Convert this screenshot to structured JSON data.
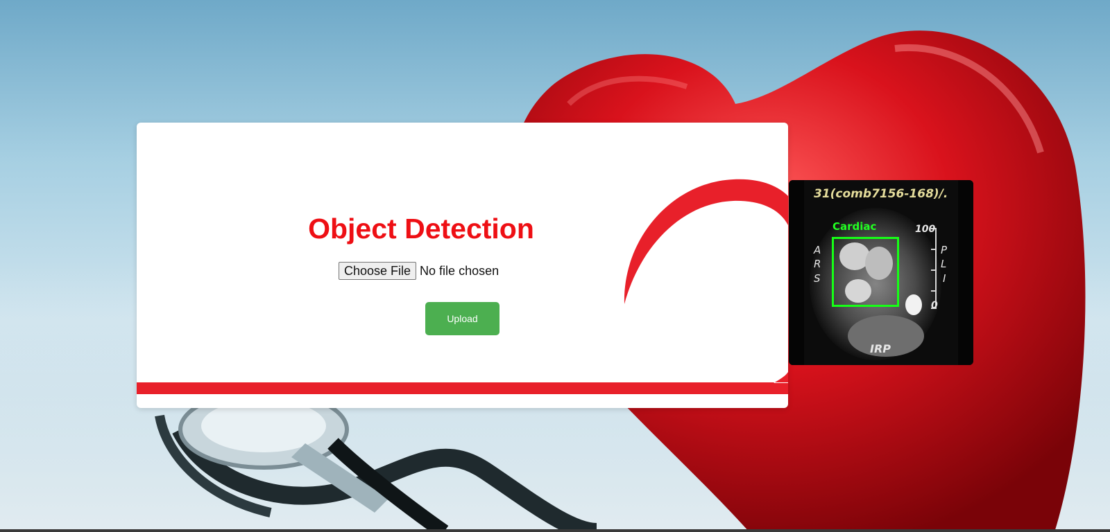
{
  "page": {
    "title": "Object Detection"
  },
  "upload_form": {
    "choose_file_label": "Choose File",
    "file_status": "No file chosen",
    "upload_label": "Upload"
  },
  "result": {
    "header_text": "31(comb7156-168)/.",
    "detection_label": "Cardiac",
    "scale_max": "100",
    "scale_min": "0",
    "orientation_left": [
      "A",
      "R",
      "S"
    ],
    "orientation_right": [
      "P",
      "L",
      "I"
    ],
    "footer_text": "IRP"
  },
  "colors": {
    "title": "#ee0f14",
    "upload_button": "#4caf50",
    "accent_red": "#e8202a",
    "detection_box": "#16ff16"
  }
}
